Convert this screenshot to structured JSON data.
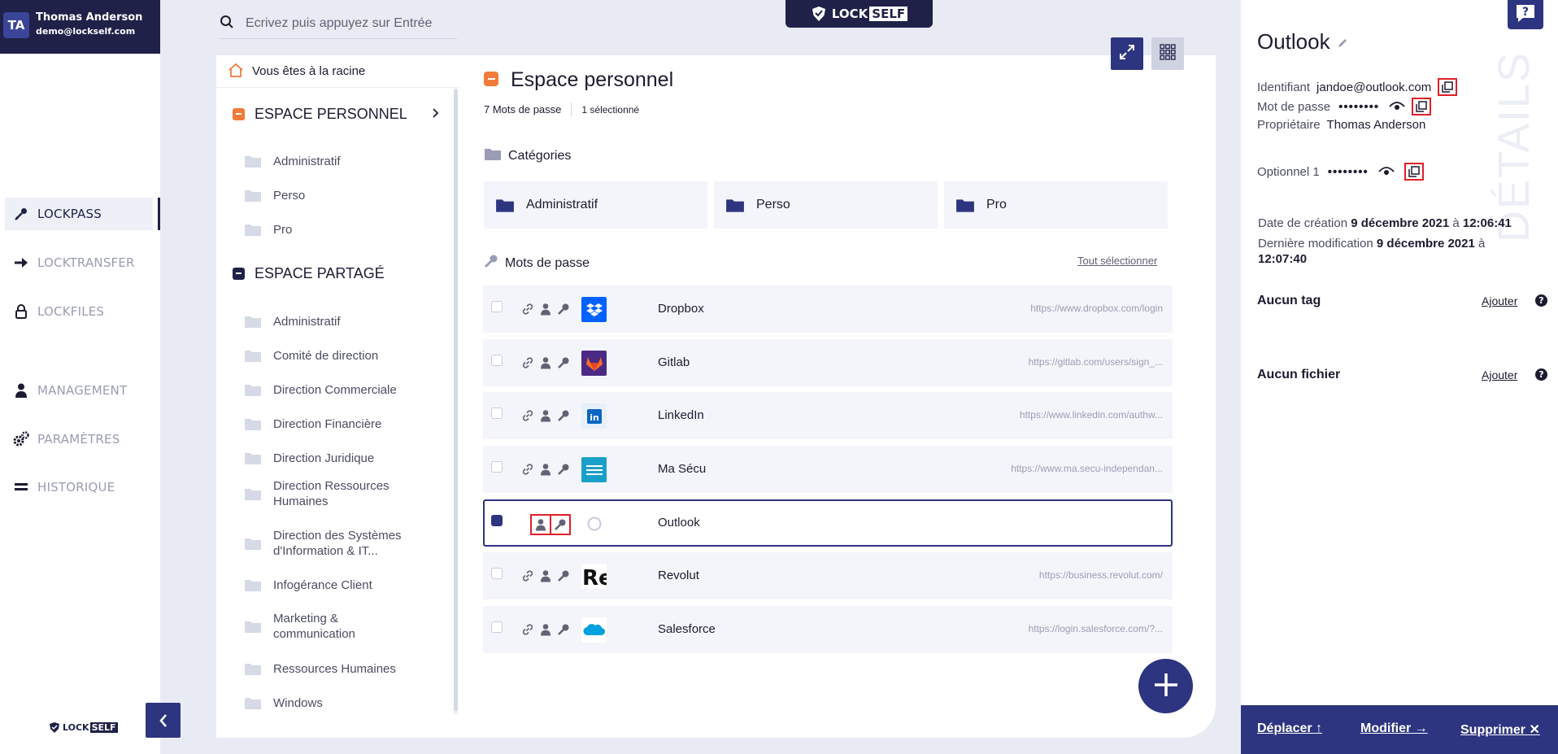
{
  "user": {
    "initials": "TA",
    "name": "Thomas Anderson",
    "email": "demo@lockself.com"
  },
  "nav": {
    "items": [
      {
        "label": "LOCKPASS",
        "icon": "key-pen-icon",
        "active": true
      },
      {
        "label": "LOCKTRANSFER",
        "icon": "arrow-right-icon",
        "active": false
      },
      {
        "label": "LOCKFILES",
        "icon": "lock-icon",
        "active": false
      },
      {
        "label": "MANAGEMENT",
        "icon": "user-icon",
        "active": false
      },
      {
        "label": "PARAMÈTRES",
        "icon": "gears-icon",
        "active": false
      },
      {
        "label": "HISTORIQUE",
        "icon": "history-icon",
        "active": false
      }
    ]
  },
  "brand": {
    "lock": "LOCK",
    "self": "SELF"
  },
  "search": {
    "placeholder": "Ecrivez puis appuyez sur Entrée"
  },
  "tree": {
    "root_label": "Vous êtes à la racine",
    "personal": {
      "label": "ESPACE PERSONNEL",
      "color": "#f07b3a",
      "folders": [
        "Administratif",
        "Perso",
        "Pro"
      ]
    },
    "shared": {
      "label": "ESPACE PARTAGÉ",
      "color": "#1f2148",
      "folders": [
        "Administratif",
        "Comité de direction",
        "Direction Commerciale",
        "Direction Financière",
        "Direction Juridique",
        "Direction Ressources Humaines",
        "Direction des Systèmes d'Information & IT...",
        "Infogérance Client",
        "Marketing & communication",
        "Ressources Humaines",
        "Windows"
      ]
    }
  },
  "main": {
    "title": "Espace personnel",
    "count_label": "7 Mots de passe",
    "selected_label": "1 sélectionné",
    "categories_title": "Catégories",
    "categories": [
      "Administratif",
      "Perso",
      "Pro"
    ],
    "passwords_title": "Mots de passe",
    "select_all": "Tout sélectionner",
    "passwords": [
      {
        "name": "Dropbox",
        "url": "https://www.dropbox.com/login",
        "logo_color": "#0061fe",
        "logo_text": "",
        "selected": false
      },
      {
        "name": "Gitlab",
        "url": "https://gitlab.com/users/sign_...",
        "logo_color": "#4b2a86",
        "logo_text": "",
        "selected": false
      },
      {
        "name": "LinkedIn",
        "url": "https://www.linkedin.com/authw...",
        "logo_color": "#e8f0fa",
        "logo_text": "in",
        "selected": false
      },
      {
        "name": "Ma Sécu",
        "url": "https://www.ma.secu-independan...",
        "logo_color": "#1aa0c8",
        "logo_text": "",
        "selected": false
      },
      {
        "name": "Outlook",
        "url": "",
        "logo_color": "#ffffff",
        "logo_text": "",
        "selected": true
      },
      {
        "name": "Revolut",
        "url": "https://business.revolut.com/",
        "logo_color": "#ffffff",
        "logo_text": "Re",
        "selected": false
      },
      {
        "name": "Salesforce",
        "url": "https://login.salesforce.com/?...",
        "logo_color": "#ffffff",
        "logo_text": "",
        "selected": false
      }
    ]
  },
  "detail": {
    "title": "Outlook",
    "vertical_label": "DÉTAILS",
    "identifier_label": "Identifiant",
    "identifier_value": "jandoe@outlook.com",
    "password_label": "Mot de passe",
    "password_mask": "••••••••",
    "owner_label": "Propriétaire",
    "owner_value": "Thomas Anderson",
    "optional_label": "Optionnel 1",
    "optional_mask": "••••••••",
    "created_label": "Date de création",
    "created_date": "9 décembre 2021",
    "created_at": "à",
    "created_time": "12:06:41",
    "modified_label": "Dernière modification",
    "modified_date": "9 décembre 2021",
    "modified_at": "à",
    "modified_time": "12:07:40",
    "tags_label": "Aucun tag",
    "files_label": "Aucun fichier",
    "add_label": "Ajouter",
    "help_glyph": "?",
    "actions": {
      "move": "Déplacer",
      "edit": "Modifier",
      "delete": "Supprimer"
    }
  }
}
